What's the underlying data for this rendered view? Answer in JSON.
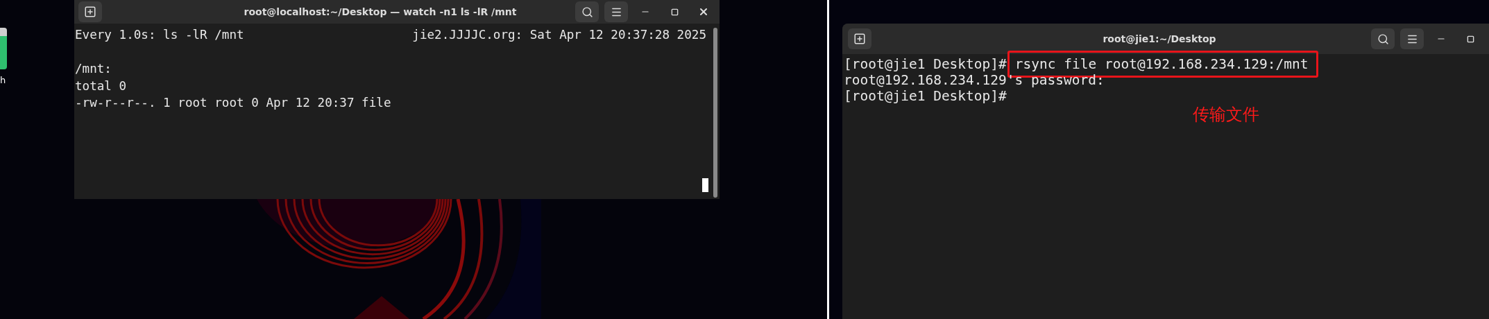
{
  "left_screen": {
    "desktop_icon": {
      "label": "h"
    },
    "terminal": {
      "title": "root@localhost:~/Desktop — watch -n1 ls -lR /mnt",
      "header_left": "Every 1.0s: ls -lR /mnt",
      "header_right": "jie2.JJJJC.org: Sat Apr 12 20:37:28 2025",
      "lines": [
        "/mnt:",
        "total 0",
        "-rw-r--r--. 1 root root 0 Apr 12 20:37 file"
      ]
    }
  },
  "right_screen": {
    "terminal": {
      "title": "root@jie1:~/Desktop",
      "lines": [
        {
          "kind": "command",
          "prompt": "[root@jie1 Desktop]#",
          "command": "rsync file root@192.168.234.129:/mnt",
          "highlighted": true
        },
        {
          "kind": "output",
          "text": "root@192.168.234.129's password:"
        },
        {
          "kind": "command",
          "prompt": "[root@jie1 Desktop]#"
        }
      ]
    },
    "annotation": {
      "text": "传输文件"
    }
  }
}
